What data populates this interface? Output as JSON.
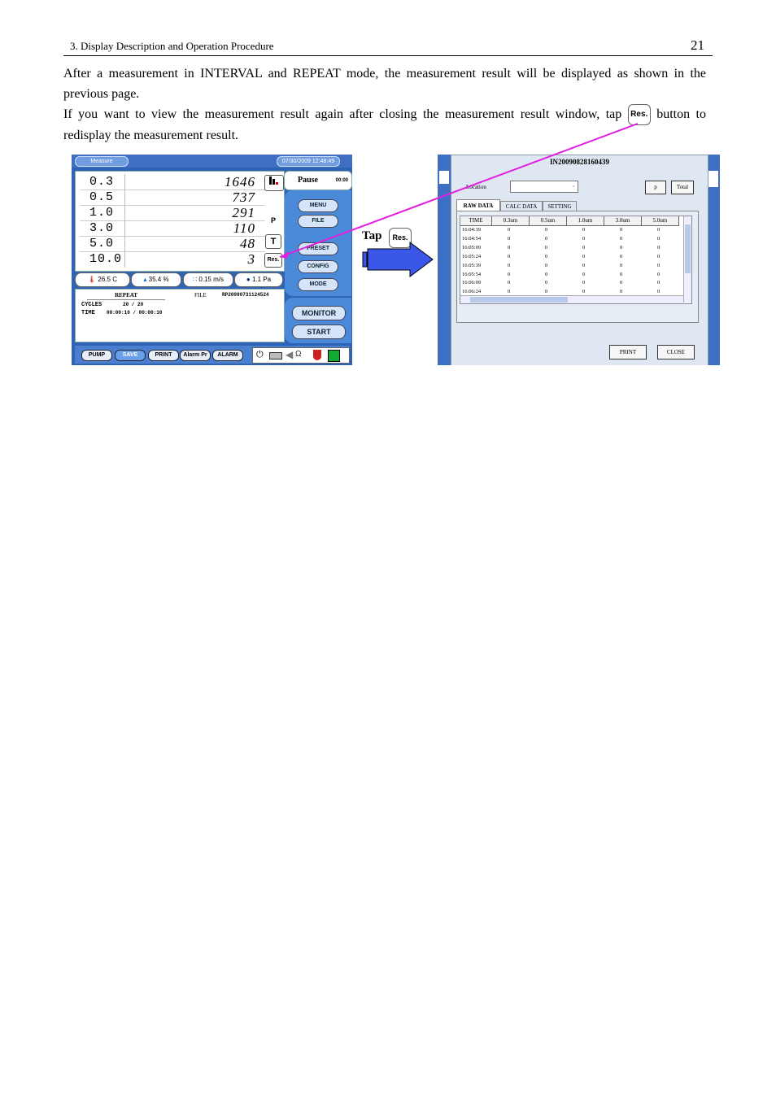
{
  "header": {
    "section": "3. Display Description and Operation Procedure",
    "page_number": "21"
  },
  "body": {
    "para1": "After a measurement in INTERVAL and REPEAT mode, the measurement result will be displayed as shown in the previous page.",
    "para2_before": "If you want to view the measurement result again after closing the measurement result window, tap",
    "res_label": "Res.",
    "para2_after": "button to redisplay the measurement result."
  },
  "left_screen": {
    "title": "Measure",
    "datetime": "07/30/2009 12:48:49",
    "rows": [
      {
        "size": "0.3",
        "count": "1646"
      },
      {
        "size": "0.5",
        "count": "737"
      },
      {
        "size": "1.0",
        "count": "291"
      },
      {
        "size": "3.0",
        "count": "110"
      },
      {
        "size": "5.0",
        "count": "48"
      },
      {
        "size": "10.0",
        "count": "3"
      }
    ],
    "side_p": "P",
    "side_t": "T",
    "side_res": "Res.",
    "pause_label": "Pause",
    "pause_time": "00:00",
    "menu_buttons": [
      "MENU",
      "FILE",
      "PRESET",
      "CONFIG",
      "MODE"
    ],
    "big_buttons": [
      "MONITOR",
      "START"
    ],
    "sensors": {
      "temp": "26.5 C",
      "humidity": "35.4 %",
      "velocity": "0.15 m/s",
      "pressure": "1.1 Pa"
    },
    "info": {
      "mode": "REPEAT",
      "file_label": "FILE",
      "file_name": "RP20090731124524",
      "cycles_label": "CYCLES",
      "cycles_value": "20  /  20",
      "time_label": "TIME",
      "time_value": "00:00:10  /  00:00:10"
    },
    "bottom_buttons": [
      "PUMP",
      "SAVE",
      "PRINT",
      "Alarm Pr",
      "ALARM"
    ]
  },
  "tap": {
    "word": "Tap",
    "res": "Res."
  },
  "dialog": {
    "title": "IN20090828160439",
    "location_label": "Location",
    "p_button": "p",
    "total_button": "Total",
    "tabs": [
      "RAW DATA",
      "CALC DATA",
      "SETTING"
    ],
    "columns": [
      "TIME",
      "0.3um",
      "0.5um",
      "1.0um",
      "3.0um",
      "5.0um"
    ],
    "rows": [
      [
        "16:04:39",
        "0",
        "0",
        "0",
        "0",
        "0"
      ],
      [
        "16:04:54",
        "0",
        "0",
        "0",
        "0",
        "0"
      ],
      [
        "16:05:09",
        "0",
        "0",
        "0",
        "0",
        "0"
      ],
      [
        "16:05:24",
        "0",
        "0",
        "0",
        "0",
        "0"
      ],
      [
        "16:05:39",
        "0",
        "0",
        "0",
        "0",
        "0"
      ],
      [
        "16:05:54",
        "0",
        "0",
        "0",
        "0",
        "0"
      ],
      [
        "16:06:09",
        "0",
        "0",
        "0",
        "0",
        "0"
      ],
      [
        "16:06:24",
        "0",
        "0",
        "0",
        "0",
        "0"
      ],
      [
        "16:06:39",
        "0",
        "0",
        "0",
        "0",
        "0"
      ]
    ],
    "print_button": "PRINT",
    "close_button": "CLOSE"
  },
  "colors": {
    "screen_blue": "#2f63b4",
    "arrow_blue": "#3a57e8",
    "pointer_magenta": "#e21fe0"
  }
}
